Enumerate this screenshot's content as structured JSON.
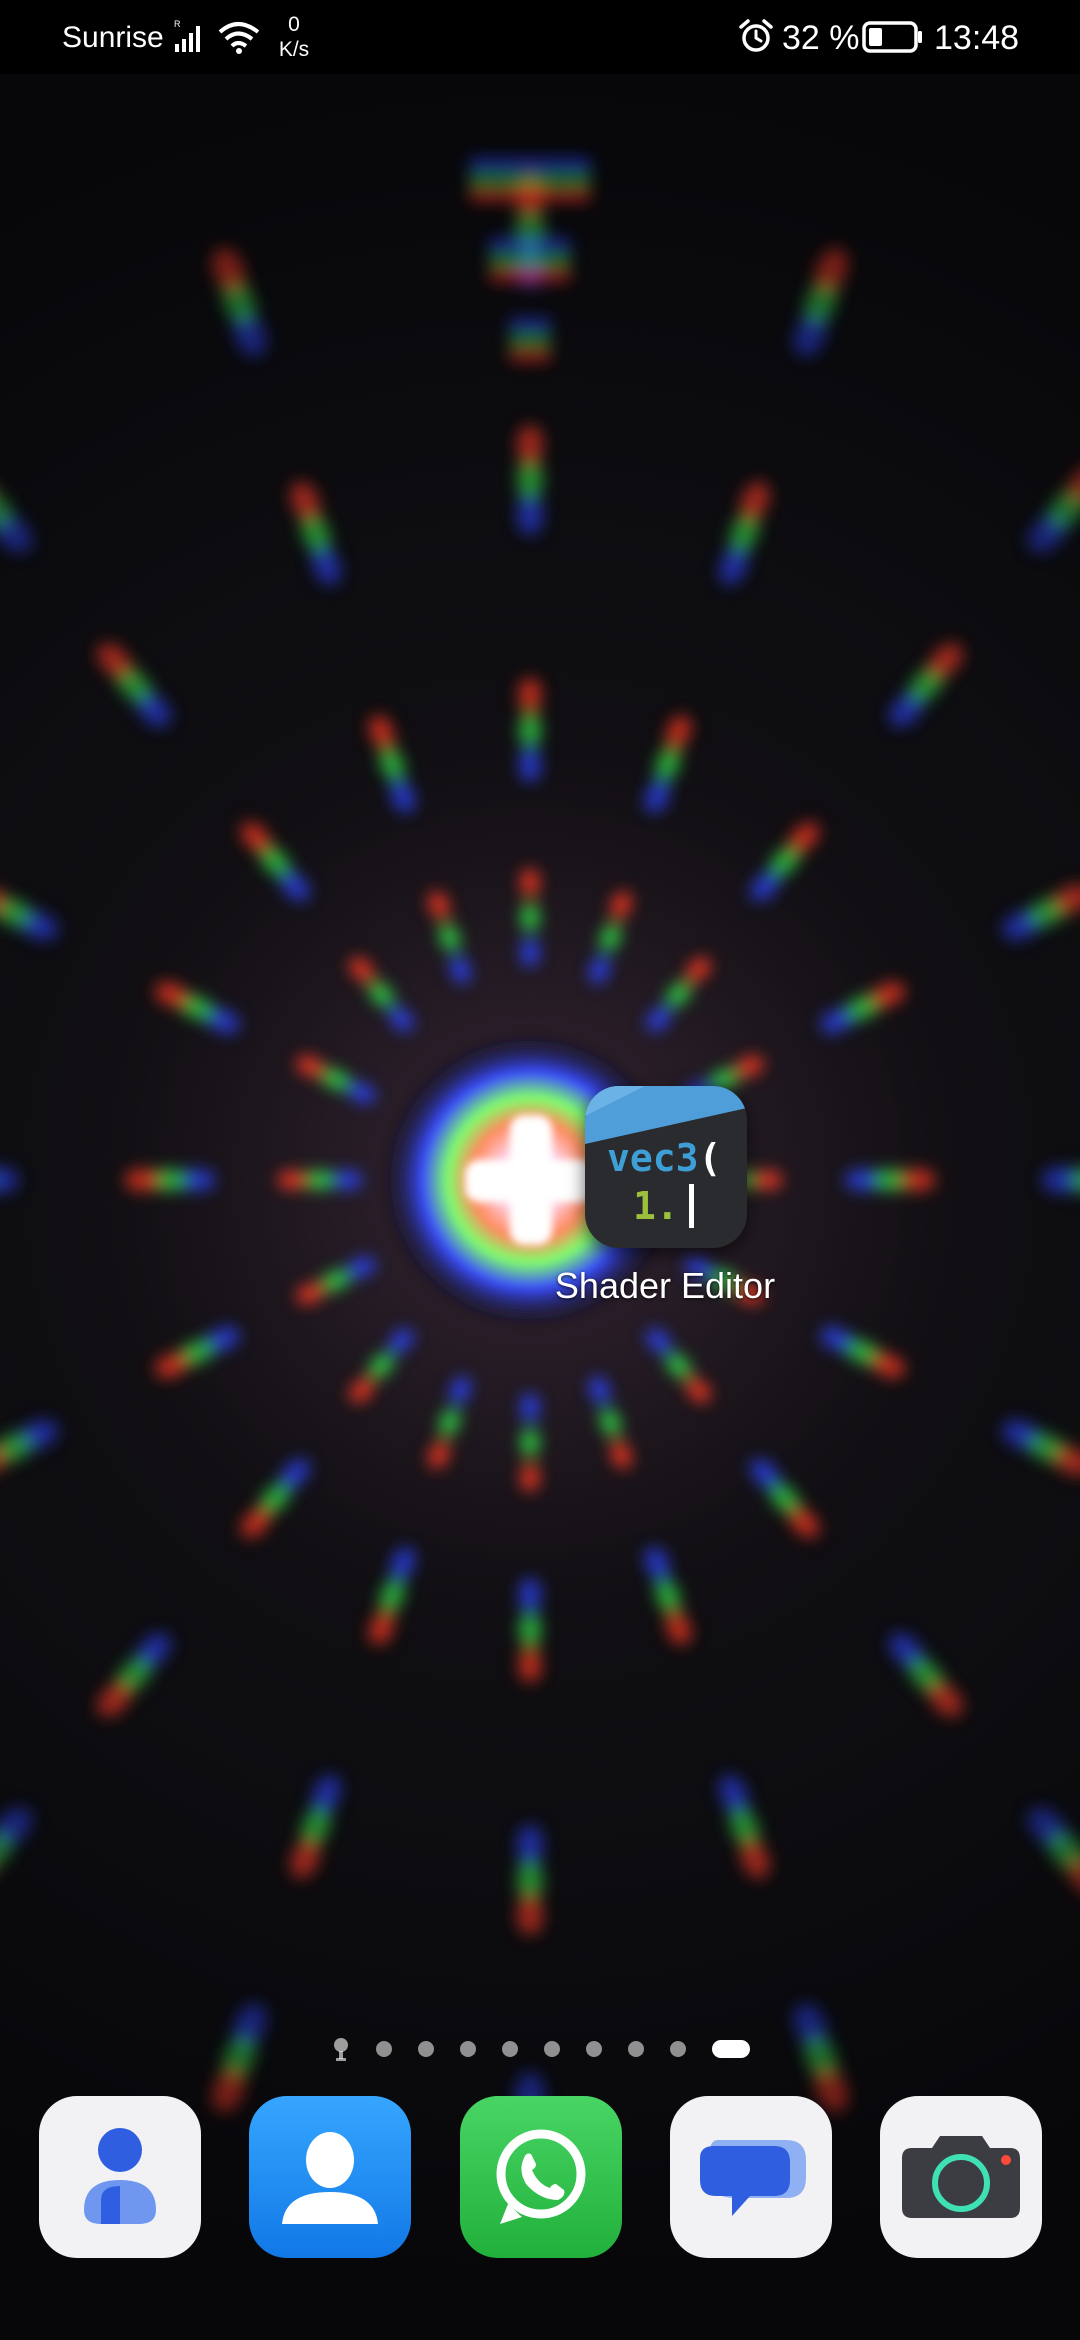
{
  "status_bar": {
    "carrier": "Sunrise",
    "signal_icon": "signal-r-icon",
    "wifi_icon": "wifi-icon",
    "net_speed_value": "0",
    "net_speed_unit": "K/s",
    "alarm_icon": "alarm-icon",
    "battery_percent": "32 %",
    "battery_level": 0.32,
    "time": "13:48"
  },
  "home": {
    "apps": [
      {
        "label": "Shader Editor",
        "icon": "shader-editor-icon",
        "code_line1": "vec3",
        "code_paren": "(",
        "code_line2": "1."
      }
    ]
  },
  "page_indicator": {
    "total_pages": 10,
    "current_page": 10,
    "first_indicator_icon": "feed-icon"
  },
  "dock": {
    "apps": [
      {
        "name": "Accounts",
        "icon": "person-icon"
      },
      {
        "name": "Contacts",
        "icon": "contacts-icon"
      },
      {
        "name": "WhatsApp",
        "icon": "whatsapp-icon"
      },
      {
        "name": "Messages",
        "icon": "messages-icon"
      },
      {
        "name": "Camera",
        "icon": "camera-icon"
      }
    ]
  },
  "colors": {
    "status_bar_bg": "#000000",
    "contacts_blue": "#1f8ef1",
    "whatsapp_green": "#35c24f",
    "messages_blue": "#4a7fe0",
    "shader_blue": "#3e9ed6",
    "shader_green": "#9cbf3c"
  }
}
